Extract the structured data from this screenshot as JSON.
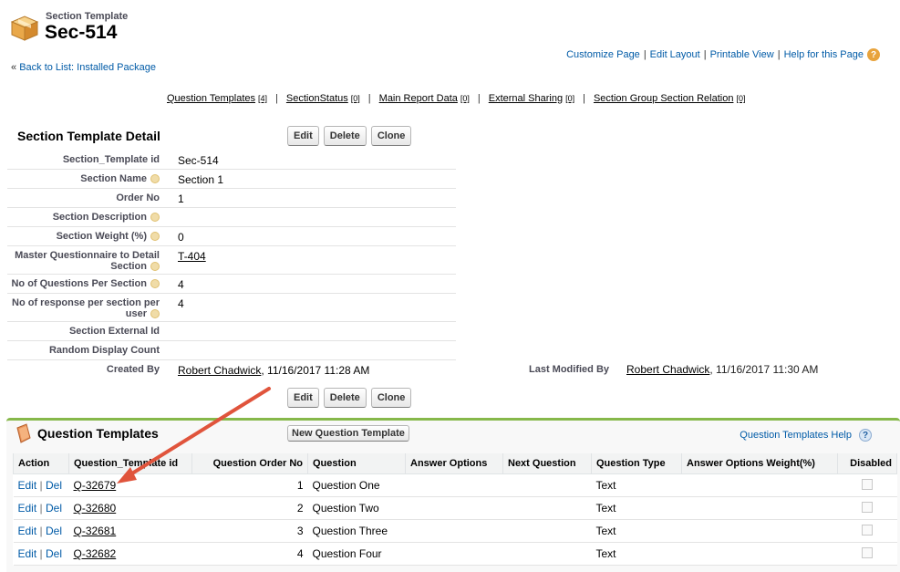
{
  "header": {
    "object_type": "Section Template",
    "record_name": "Sec-514",
    "icon": "package-icon"
  },
  "top_links": [
    "Customize Page",
    "Edit Layout",
    "Printable View",
    "Help for this Page"
  ],
  "back_link": {
    "prefix": "« ",
    "label": "Back to List: Installed Package"
  },
  "related_links": [
    {
      "label": "Question Templates",
      "count": "[4]"
    },
    {
      "label": "SectionStatus",
      "count": "[0]"
    },
    {
      "label": "Main Report Data",
      "count": "[0]"
    },
    {
      "label": "External Sharing",
      "count": "[0]"
    },
    {
      "label": "Section Group Section Relation",
      "count": "[0]"
    }
  ],
  "detail": {
    "title": "Section Template Detail",
    "buttons": {
      "edit": "Edit",
      "delete": "Delete",
      "clone": "Clone"
    },
    "fields": {
      "id_label": "Section_Template id",
      "id_value": "Sec-514",
      "name_label": "Section Name",
      "name_value": "Section 1",
      "order_label": "Order No",
      "order_value": "1",
      "desc_label": "Section Description",
      "desc_value": "",
      "weight_label": "Section Weight (%)",
      "weight_value": "0",
      "master_label_1": "Master Questionnaire to Detail",
      "master_label_2": "Section",
      "master_value": "T-404",
      "nq_label": "No of Questions Per Section",
      "nq_value": "4",
      "nr_label_1": "No of response per section per",
      "nr_label_2": "user",
      "nr_value": "4",
      "ext_label": "Section External Id",
      "ext_value": "",
      "rdc_label": "Random Display Count",
      "rdc_value": "",
      "created_label": "Created By",
      "created_user": "Robert Chadwick",
      "created_date": ", 11/16/2017 11:28 AM",
      "modified_label": "Last Modified By",
      "modified_user": "Robert Chadwick",
      "modified_date": ", 11/16/2017 11:30 AM"
    }
  },
  "question_templates": {
    "title": "Question Templates",
    "new_button": "New Question Template",
    "help_label": "Question Templates Help",
    "columns": [
      "Action",
      "Question_Template id",
      "Question Order No",
      "Question",
      "Answer Options",
      "Next Question",
      "Question Type",
      "Answer Options Weight(%)",
      "Disabled"
    ],
    "action_edit": "Edit",
    "action_sep": " | ",
    "action_del": "Del",
    "rows": [
      {
        "id": "Q-32679",
        "order": "1",
        "question": "Question One",
        "answer_options": "",
        "next_question": "",
        "type": "Text",
        "weight": ""
      },
      {
        "id": "Q-32680",
        "order": "2",
        "question": "Question Two",
        "answer_options": "",
        "next_question": "",
        "type": "Text",
        "weight": ""
      },
      {
        "id": "Q-32681",
        "order": "3",
        "question": "Question Three",
        "answer_options": "",
        "next_question": "",
        "type": "Text",
        "weight": ""
      },
      {
        "id": "Q-32682",
        "order": "4",
        "question": "Question Four",
        "answer_options": "",
        "next_question": "",
        "type": "Text",
        "weight": ""
      }
    ]
  },
  "colors": {
    "accent_green": "#86b84a",
    "link_blue": "#015ba7",
    "annotation_arrow": "#e0543c"
  }
}
